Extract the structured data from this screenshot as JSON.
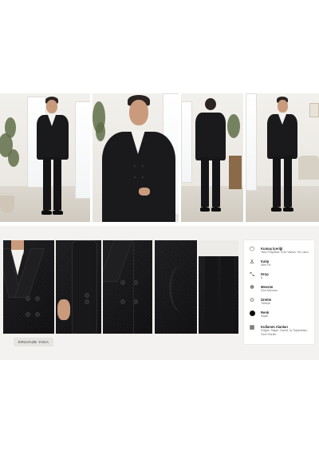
{
  "detail_badge": "KRUVAZE YAKA",
  "specs": [
    {
      "icon": "fabric-icon",
      "title": "Kumaş İçeriği",
      "value": "%64 Polyester %34 Viskon %2 Likra"
    },
    {
      "icon": "hanger-icon",
      "title": "Kalıp",
      "value": "Slim Fit"
    },
    {
      "icon": "ruler-icon",
      "title": "Drop",
      "value": "6"
    },
    {
      "icon": "season-icon",
      "title": "Mevsim",
      "value": "Dört Mevsim"
    },
    {
      "icon": "location-icon",
      "title": "Üretim",
      "value": "Türkiye"
    },
    {
      "icon": "color-dot-icon",
      "title": "Renk",
      "value": "Siyah",
      "color": "#0a0a0a"
    },
    {
      "icon": "calendar-icon",
      "title": "Kullanım Alanları",
      "value": "Düğün, Nişan, Davet, İş Toplantıları, Özel Günler"
    }
  ],
  "colors": {
    "suit": "#151517",
    "background": "#f3f2f0",
    "card": "#ffffff"
  }
}
